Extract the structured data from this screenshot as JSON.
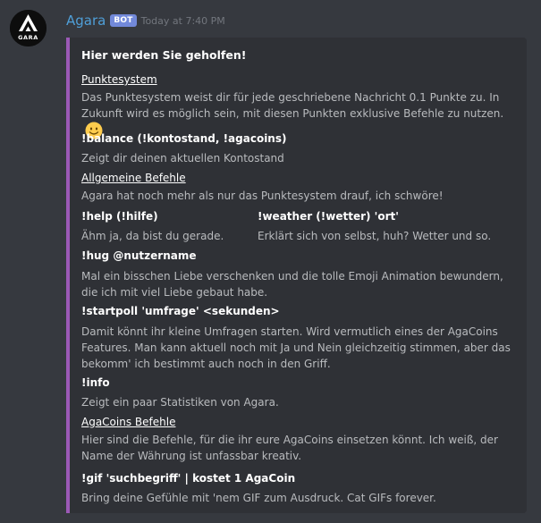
{
  "message": {
    "username": "Agara",
    "bot_tag": "BOT",
    "timestamp": "Today at 7:40 PM",
    "avatar_text": "GARA"
  },
  "embed": {
    "accent_color": "#9b59b6",
    "title": "Hier werden Sie geholfen!",
    "fields": [
      {
        "name": "Punktesystem",
        "value": "Das Punktesystem weist dir für jede geschriebene Nachricht 0.1 Punkte zu. In Zukunft wird es möglich sein, mit diesen Punkten exklusive Befehle zu nutzen.",
        "emoji": "slightly-smiling-face"
      },
      {
        "name": "!balance (!kontostand, !agacoins)",
        "value": "Zeigt dir deinen aktuellen Kontostand"
      },
      {
        "name": "Allgemeine Befehle",
        "value": "Agara hat noch mehr als nur das Punktesystem drauf, ich schwöre!"
      },
      {
        "name": "!help (!hilfe)",
        "value": "Ähm ja, da bist du gerade."
      },
      {
        "name": "!weather (!wetter) 'ort'",
        "value": "Erklärt sich von selbst, huh? Wetter und so."
      },
      {
        "name": "!hug @nutzername",
        "value": "Mal ein bisschen Liebe verschenken und die tolle Emoji Animation bewundern, die ich mit viel Liebe gebaut habe."
      },
      {
        "name": "!startpoll 'umfrage' <sekunden>",
        "value": "Damit könnt ihr kleine Umfragen starten. Wird vermutlich eines der AgaCoins Features. Man kann aktuell noch mit Ja und Nein gleichzeitig stimmen, aber das bekomm' ich bestimmt auch noch in den Griff."
      },
      {
        "name": "!info",
        "value": "Zeigt ein paar Statistiken von Agara."
      },
      {
        "name": "AgaCoins Befehle ",
        "value": "Hier sind die Befehle, für die ihr eure AgaCoins einsetzen könnt. Ich weiß, der Name der Währung ist unfassbar kreativ."
      },
      {
        "name": "!gif 'suchbegriff' | kostet 1 AgaCoin",
        "value": "Bring deine Gefühle mit 'nem GIF zum Ausdruck. Cat GIFs forever."
      }
    ]
  }
}
